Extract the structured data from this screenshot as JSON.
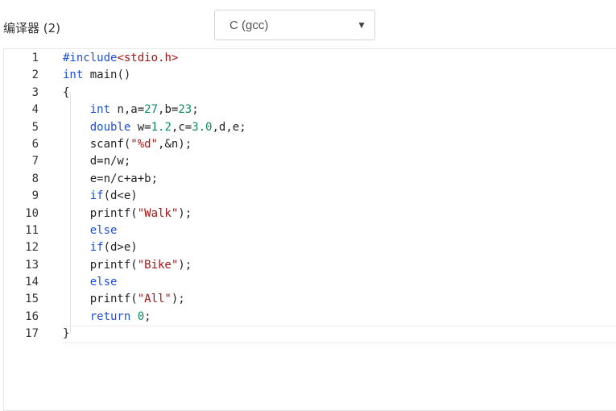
{
  "header": {
    "compiler_label": "编译器 (2)",
    "language_select": {
      "value": "C (gcc)",
      "arrow": "▼"
    }
  },
  "editor": {
    "active_line": 17,
    "lines": [
      {
        "n": "1",
        "tokens": [
          {
            "t": "pp",
            "v": "#include"
          },
          {
            "t": "hdr",
            "v": "<stdio.h>"
          }
        ]
      },
      {
        "n": "2",
        "tokens": [
          {
            "t": "kw",
            "v": "int"
          },
          {
            "t": "plain",
            "v": " main()"
          }
        ]
      },
      {
        "n": "3",
        "tokens": [
          {
            "t": "plain",
            "v": "{"
          }
        ]
      },
      {
        "n": "4",
        "tokens": [
          {
            "t": "plain",
            "v": "    "
          },
          {
            "t": "kw",
            "v": "int"
          },
          {
            "t": "plain",
            "v": " n,a="
          },
          {
            "t": "num-lit",
            "v": "27"
          },
          {
            "t": "plain",
            "v": ",b="
          },
          {
            "t": "num-lit",
            "v": "23"
          },
          {
            "t": "plain",
            "v": ";"
          }
        ]
      },
      {
        "n": "5",
        "tokens": [
          {
            "t": "plain",
            "v": "    "
          },
          {
            "t": "kw",
            "v": "double"
          },
          {
            "t": "plain",
            "v": " w="
          },
          {
            "t": "num-lit",
            "v": "1.2"
          },
          {
            "t": "plain",
            "v": ",c="
          },
          {
            "t": "num-lit",
            "v": "3.0"
          },
          {
            "t": "plain",
            "v": ",d,e;"
          }
        ]
      },
      {
        "n": "6",
        "tokens": [
          {
            "t": "plain",
            "v": "    scanf("
          },
          {
            "t": "str",
            "v": "\"%d\""
          },
          {
            "t": "plain",
            "v": ",&n);"
          }
        ]
      },
      {
        "n": "7",
        "tokens": [
          {
            "t": "plain",
            "v": "    d=n/w;"
          }
        ]
      },
      {
        "n": "8",
        "tokens": [
          {
            "t": "plain",
            "v": "    e=n/c+a+b;"
          }
        ]
      },
      {
        "n": "9",
        "tokens": [
          {
            "t": "plain",
            "v": "    "
          },
          {
            "t": "kw",
            "v": "if"
          },
          {
            "t": "plain",
            "v": "(d<e)"
          }
        ]
      },
      {
        "n": "10",
        "tokens": [
          {
            "t": "plain",
            "v": "    printf("
          },
          {
            "t": "str",
            "v": "\"Walk\""
          },
          {
            "t": "plain",
            "v": ");"
          }
        ]
      },
      {
        "n": "11",
        "tokens": [
          {
            "t": "plain",
            "v": "    "
          },
          {
            "t": "kw",
            "v": "else"
          }
        ]
      },
      {
        "n": "12",
        "tokens": [
          {
            "t": "plain",
            "v": "    "
          },
          {
            "t": "kw",
            "v": "if"
          },
          {
            "t": "plain",
            "v": "(d>e)"
          }
        ]
      },
      {
        "n": "13",
        "tokens": [
          {
            "t": "plain",
            "v": "    printf("
          },
          {
            "t": "str",
            "v": "\"Bike\""
          },
          {
            "t": "plain",
            "v": ");"
          }
        ]
      },
      {
        "n": "14",
        "tokens": [
          {
            "t": "plain",
            "v": "    "
          },
          {
            "t": "kw",
            "v": "else"
          }
        ]
      },
      {
        "n": "15",
        "tokens": [
          {
            "t": "plain",
            "v": "    printf("
          },
          {
            "t": "str",
            "v": "\"All\""
          },
          {
            "t": "plain",
            "v": ");"
          }
        ]
      },
      {
        "n": "16",
        "tokens": [
          {
            "t": "plain",
            "v": "    "
          },
          {
            "t": "kw",
            "v": "return"
          },
          {
            "t": "plain",
            "v": " "
          },
          {
            "t": "num-lit",
            "v": "0"
          },
          {
            "t": "plain",
            "v": ";"
          }
        ]
      },
      {
        "n": "17",
        "tokens": [
          {
            "t": "plain",
            "v": "}"
          }
        ]
      }
    ]
  },
  "colors": {
    "keyword": "#1f4fd6",
    "string": "#a31515",
    "number": "#0a8f5b",
    "text": "#222222"
  }
}
